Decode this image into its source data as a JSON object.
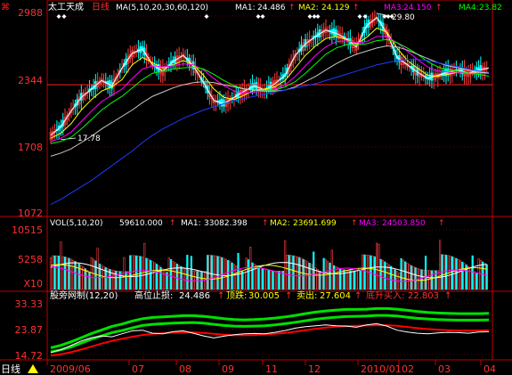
{
  "colors": {
    "background": "#000000",
    "frame": "#c00000",
    "axis_text": "#ff3030",
    "up": "#ff4040",
    "down": "#00ffff",
    "ma1": "#ffffff",
    "ma2": "#ffff00",
    "ma3": "#ff00ff",
    "ma4": "#00ff00",
    "ma5": "#c8c8c8",
    "ma6": "#1a3cff",
    "boll_upper": "#00e000",
    "boll_lower": "#ff0000",
    "boll_mid": "#ffffff",
    "cursor": "#ff2020"
  },
  "main_panel": {
    "stock_name": "太工天成",
    "period": "日线",
    "ma_params": "MA(5,10,20,30,60,120)",
    "ma1_label": "MA1:",
    "ma1_value": "24.486",
    "ma2_label": "MA2:",
    "ma2_value": "24.129",
    "ma3_label": "MA3:",
    "ma3_value": "24.150",
    "ma4_label": "MA4:",
    "ma4_value": "23.82",
    "arrow": "↑",
    "high_note": "29.80",
    "low_note": "17.78",
    "y_ticks": [
      "2988",
      "2344",
      "1708",
      "1072"
    ]
  },
  "volume_panel": {
    "label": "VOL(5,10,20)",
    "volume": "59610.000",
    "ma1_label": "MA1:",
    "ma1_value": "33082.398",
    "ma2_label": "MA2:",
    "ma2_value": "23691.699",
    "ma3_label": "MA3:",
    "ma3_value": "24503.850",
    "arrow": "↑",
    "y_ticks": [
      "10515",
      "5258",
      "X10"
    ]
  },
  "indicator_panel": {
    "label": "股旁网制(12,20)",
    "stop_label": "高位止损:",
    "stop_value": "24.486",
    "top_label": "顶跌:",
    "top_value": "30.005",
    "sell_label": "卖出:",
    "sell_value": "27.604",
    "buy_label": "底升买入:",
    "buy_value": "22.803",
    "arrow": "↑",
    "y_ticks": [
      "33.33",
      "23.87",
      "14.72"
    ]
  },
  "x_axis": {
    "period_label": "日线",
    "labels": [
      "2009/06",
      "07",
      "08",
      "09",
      "11",
      "12",
      "2010/01",
      "02",
      "03",
      "04"
    ]
  },
  "chart_data": {
    "type": "candlestick",
    "price_range": [
      10.72,
      29.88
    ],
    "high": 29.8,
    "low": 17.78,
    "last_ma": {
      "MA1": 24.486,
      "MA2": 24.129,
      "MA3": 24.15,
      "MA4": 23.82
    },
    "volume_range": [
      0,
      10515
    ],
    "indicator_range": [
      14.72,
      33.33
    ],
    "month_positions": {
      "2009/06": 0,
      "07": 1,
      "08": 2,
      "09": 3,
      "11": 4,
      "12": 5,
      "2010/01": 6,
      "02": 7,
      "03": 8,
      "04": 9
    },
    "series": [
      {
        "name": "MA1",
        "values": [
          18.2,
          19.0,
          20.5,
          21.8,
          22.6,
          23.4,
          22.9,
          24.6,
          26.0,
          26.4,
          24.9,
          24.3,
          25.2,
          25.8,
          24.8,
          23.2,
          21.5,
          21.2,
          21.8,
          22.4,
          22.9,
          22.5,
          23.1,
          23.9,
          25.8,
          26.9,
          27.6,
          28.2,
          27.9,
          27.4,
          26.6,
          28.6,
          29.4,
          27.9,
          25.6,
          24.9,
          24.2,
          23.6,
          23.9,
          24.2,
          24.4,
          24.1,
          24.4,
          24.6
        ]
      },
      {
        "name": "MA2",
        "values": [
          17.9,
          18.4,
          19.3,
          20.6,
          21.6,
          22.4,
          22.8,
          23.5,
          24.9,
          25.6,
          25.1,
          24.6,
          24.9,
          25.3,
          24.9,
          23.9,
          22.6,
          21.8,
          21.6,
          22.0,
          22.5,
          22.6,
          22.8,
          23.4,
          24.6,
          25.8,
          26.7,
          27.4,
          27.6,
          27.3,
          26.9,
          27.5,
          28.4,
          28.0,
          26.5,
          25.3,
          24.6,
          23.9,
          23.8,
          24.0,
          24.2,
          24.1,
          24.2,
          24.13
        ]
      },
      {
        "name": "MA3",
        "values": [
          17.6,
          17.9,
          18.5,
          19.5,
          20.5,
          21.4,
          22.0,
          22.6,
          23.6,
          24.5,
          24.8,
          24.7,
          24.8,
          25.0,
          24.9,
          24.4,
          23.6,
          22.9,
          22.4,
          22.2,
          22.3,
          22.4,
          22.6,
          23.0,
          23.8,
          24.8,
          25.8,
          26.6,
          27.1,
          27.2,
          27.0,
          27.1,
          27.6,
          27.6,
          27.0,
          26.2,
          25.4,
          24.7,
          24.3,
          24.2,
          24.2,
          24.1,
          24.1,
          24.15
        ]
      },
      {
        "name": "MA4",
        "values": [
          17.4,
          17.6,
          18.0,
          18.8,
          19.7,
          20.6,
          21.3,
          21.9,
          22.7,
          23.5,
          24.1,
          24.3,
          24.5,
          24.6,
          24.7,
          24.5,
          24.0,
          23.4,
          22.9,
          22.6,
          22.5,
          22.5,
          22.5,
          22.8,
          23.3,
          24.1,
          25.0,
          25.9,
          26.5,
          26.8,
          26.8,
          26.9,
          27.2,
          27.3,
          27.0,
          26.5,
          25.9,
          25.2,
          24.7,
          24.4,
          24.3,
          24.1,
          24.0,
          23.82
        ]
      },
      {
        "name": "MA5",
        "values": [
          16.2,
          16.5,
          16.9,
          17.5,
          18.1,
          18.8,
          19.4,
          20.0,
          20.6,
          21.3,
          21.9,
          22.3,
          22.7,
          23.0,
          23.2,
          23.3,
          23.2,
          23.0,
          22.8,
          22.6,
          22.5,
          22.4,
          22.4,
          22.5,
          22.8,
          23.3,
          23.8,
          24.4,
          25.0,
          25.5,
          25.9,
          26.2,
          26.5,
          26.7,
          26.6,
          26.3,
          25.9,
          25.5,
          25.1,
          24.8,
          24.6,
          24.4,
          24.2,
          24.1
        ]
      },
      {
        "name": "MA6",
        "values": [
          11.6,
          12.1,
          12.7,
          13.3,
          13.9,
          14.6,
          15.3,
          16.0,
          16.7,
          17.5,
          18.2,
          18.8,
          19.3,
          19.8,
          20.2,
          20.6,
          20.9,
          21.2,
          21.5,
          21.7,
          21.9,
          22.1,
          22.3,
          22.5,
          22.7,
          22.9,
          23.1,
          23.4,
          23.7,
          24.0,
          24.3,
          24.6,
          24.9,
          25.1,
          25.3,
          25.4,
          25.4,
          25.3,
          25.1,
          24.9,
          24.7,
          24.5,
          24.3,
          24.2
        ]
      }
    ],
    "indicator_series": [
      {
        "name": "upper",
        "values": [
          17.6,
          18.4,
          19.6,
          21.0,
          22.4,
          23.6,
          24.8,
          25.6,
          26.6,
          27.4,
          27.8,
          28.0,
          28.2,
          28.4,
          28.4,
          28.2,
          27.8,
          27.4,
          27.1,
          27.0,
          27.1,
          27.3,
          27.6,
          28.0,
          28.5,
          29.1,
          29.6,
          30.0,
          30.3,
          30.5,
          30.5,
          30.6,
          30.8,
          30.8,
          30.6,
          30.2,
          29.8,
          29.5,
          29.3,
          29.2,
          29.1,
          29.1,
          29.1,
          29.2
        ]
      },
      {
        "name": "middle",
        "values": [
          16.2,
          16.9,
          17.9,
          19.2,
          20.5,
          21.6,
          22.7,
          23.4,
          24.3,
          25.1,
          25.5,
          25.7,
          25.9,
          26.0,
          26.1,
          25.9,
          25.5,
          25.1,
          24.9,
          24.8,
          24.9,
          25.0,
          25.3,
          25.7,
          26.2,
          26.7,
          27.2,
          27.6,
          27.9,
          28.1,
          28.2,
          28.3,
          28.5,
          28.5,
          28.3,
          27.9,
          27.5,
          27.3,
          27.1,
          27.0,
          26.9,
          26.9,
          26.9,
          27.0
        ]
      },
      {
        "name": "lower",
        "values": [
          15.0,
          15.4,
          16.1,
          17.0,
          18.0,
          19.0,
          19.9,
          20.6,
          21.3,
          21.9,
          22.3,
          22.5,
          22.7,
          22.8,
          22.8,
          22.6,
          22.3,
          22.0,
          21.8,
          21.8,
          21.9,
          22.1,
          22.3,
          22.6,
          23.0,
          23.5,
          24.0,
          24.4,
          24.7,
          24.9,
          25.0,
          25.1,
          25.2,
          25.2,
          25.0,
          24.6,
          24.2,
          23.9,
          23.7,
          23.5,
          23.4,
          23.4,
          23.4,
          23.5
        ]
      },
      {
        "name": "price",
        "values": [
          16.0,
          16.9,
          18.4,
          19.9,
          21.0,
          21.6,
          21.3,
          22.3,
          23.3,
          23.5,
          22.5,
          22.3,
          23.0,
          23.3,
          22.5,
          21.6,
          20.9,
          21.5,
          22.0,
          22.3,
          22.4,
          22.3,
          22.8,
          23.4,
          24.2,
          24.7,
          25.0,
          25.3,
          25.0,
          24.9,
          24.5,
          25.3,
          25.7,
          24.9,
          23.5,
          22.9,
          22.5,
          22.3,
          22.6,
          22.8,
          22.7,
          22.5,
          22.9,
          23.0
        ]
      }
    ]
  }
}
